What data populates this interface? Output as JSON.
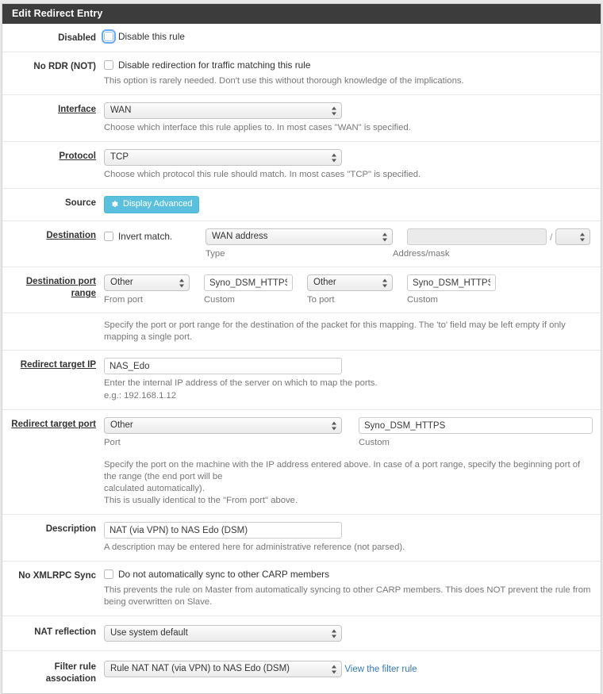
{
  "panel": {
    "title": "Edit Redirect Entry"
  },
  "rows": {
    "disabled": {
      "label": "Disabled",
      "checkbox_label": "Disable this rule",
      "checked": false
    },
    "no_rdr": {
      "label": "No RDR (NOT)",
      "checkbox_label": "Disable redirection for traffic matching this rule",
      "help": "This option is rarely needed. Don't use this without thorough knowledge of the implications.",
      "checked": false
    },
    "interface": {
      "label": "Interface",
      "value": "WAN",
      "help": "Choose which interface this rule applies to. In most cases \"WAN\" is specified."
    },
    "protocol": {
      "label": "Protocol",
      "value": "TCP",
      "help": "Choose which protocol this rule should match. In most cases \"TCP\" is specified."
    },
    "source": {
      "label": "Source",
      "button_label": "Display Advanced",
      "button_icon": "gear-icon",
      "button_color": "#5bc0de"
    },
    "destination": {
      "label": "Destination",
      "invert_label": "Invert match.",
      "invert_checked": false,
      "type_value": "WAN address",
      "type_sublabel": "Type",
      "address_value": "",
      "address_placeholder": "",
      "separator": "/",
      "mask_value": "",
      "address_sublabel": "Address/mask"
    },
    "dest_port_range": {
      "label": "Destination port range",
      "from_port_value": "Other",
      "from_port_sublabel": "From port",
      "from_custom_value": "Syno_DSM_HTTPS",
      "from_custom_sublabel": "Custom",
      "to_port_value": "Other",
      "to_port_sublabel": "To port",
      "to_custom_value": "Syno_DSM_HTTPS",
      "to_custom_sublabel": "Custom",
      "help": "Specify the port or port range for the destination of the packet for this mapping. The 'to' field may be left empty if only mapping a single port."
    },
    "redirect_target_ip": {
      "label": "Redirect target IP",
      "value": "NAS_Edo",
      "help_line1": "Enter the internal IP address of the server on which to map the ports.",
      "help_line2": "e.g.: 192.168.1.12"
    },
    "redirect_target_port": {
      "label": "Redirect target port",
      "port_value": "Other",
      "port_sublabel": "Port",
      "custom_value": "Syno_DSM_HTTPS",
      "custom_sublabel": "Custom",
      "help_line1": "Specify the port on the machine with the IP address entered above. In case of a port range, specify the beginning port of the range (the end port will be",
      "help_line2": "calculated automatically).",
      "help_line3": "This is usually identical to the \"From port\" above."
    },
    "description": {
      "label": "Description",
      "value": "NAT (via VPN) to NAS Edo (DSM)",
      "help": "A description may be entered here for administrative reference (not parsed)."
    },
    "no_xmlrpc_sync": {
      "label": "No XMLRPC Sync",
      "checkbox_label": "Do not automatically sync to other CARP members",
      "checked": false,
      "help": "This prevents the rule on Master from automatically syncing to other CARP members. This does NOT prevent the rule from being overwritten on Slave."
    },
    "nat_reflection": {
      "label": "NAT reflection",
      "value": "Use system default"
    },
    "filter_rule_association": {
      "label": "Filter rule association",
      "value": "Rule NAT NAT (via VPN) to NAS Edo (DSM)",
      "link_label": "View the filter rule"
    }
  }
}
